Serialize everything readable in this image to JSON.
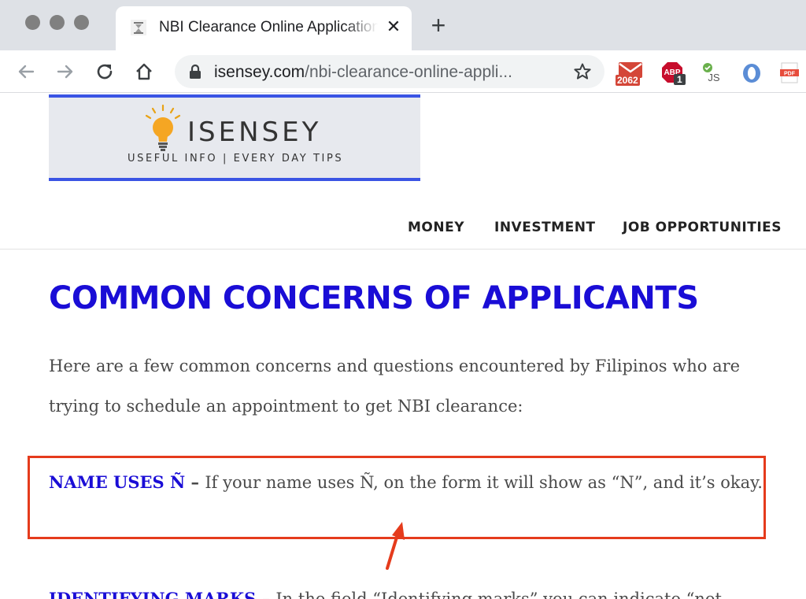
{
  "browser": {
    "tab": {
      "title": "NBI Clearance Online Application",
      "close_glyph": "✕"
    },
    "new_tab_glyph": "+",
    "url": {
      "host": "isensey.com",
      "path": "/nbi-clearance-online-appli..."
    },
    "extensions": [
      {
        "name": "gmail-checker",
        "badge": "2062"
      },
      {
        "name": "adblock",
        "label": "ABP",
        "badge": "1"
      },
      {
        "name": "js-toggle",
        "label": "JS"
      },
      {
        "name": "opera-extension",
        "label": ""
      },
      {
        "name": "pdf-extension",
        "label": "PDF"
      }
    ]
  },
  "site": {
    "logo": {
      "name": "ISENSEY",
      "tagline": "USEFUL INFO | EVERY DAY TIPS"
    },
    "menu": [
      {
        "label": "MONEY"
      },
      {
        "label": "INVESTMENT"
      },
      {
        "label": "JOB OPPORTUNITIES"
      }
    ]
  },
  "article": {
    "heading": "COMMON CONCERNS OF APPLICANTS",
    "intro": "Here are a few common concerns and questions encountered by Filipinos who are trying to schedule an appointment to get NBI clearance:",
    "items": [
      {
        "term": "NAME USES Ñ",
        "dash": " – ",
        "text": "If your name uses Ñ, on the form it will show as “N”, and it’s okay."
      },
      {
        "term": "IDENTIFYING MARKS",
        "dash": " – ",
        "text": "In the field “Identifying marks” you can indicate “not"
      }
    ]
  },
  "colors": {
    "accent_blue": "#1a0dd6",
    "logo_bar": "#3b54e4",
    "annotation_red": "#e53b1c"
  }
}
